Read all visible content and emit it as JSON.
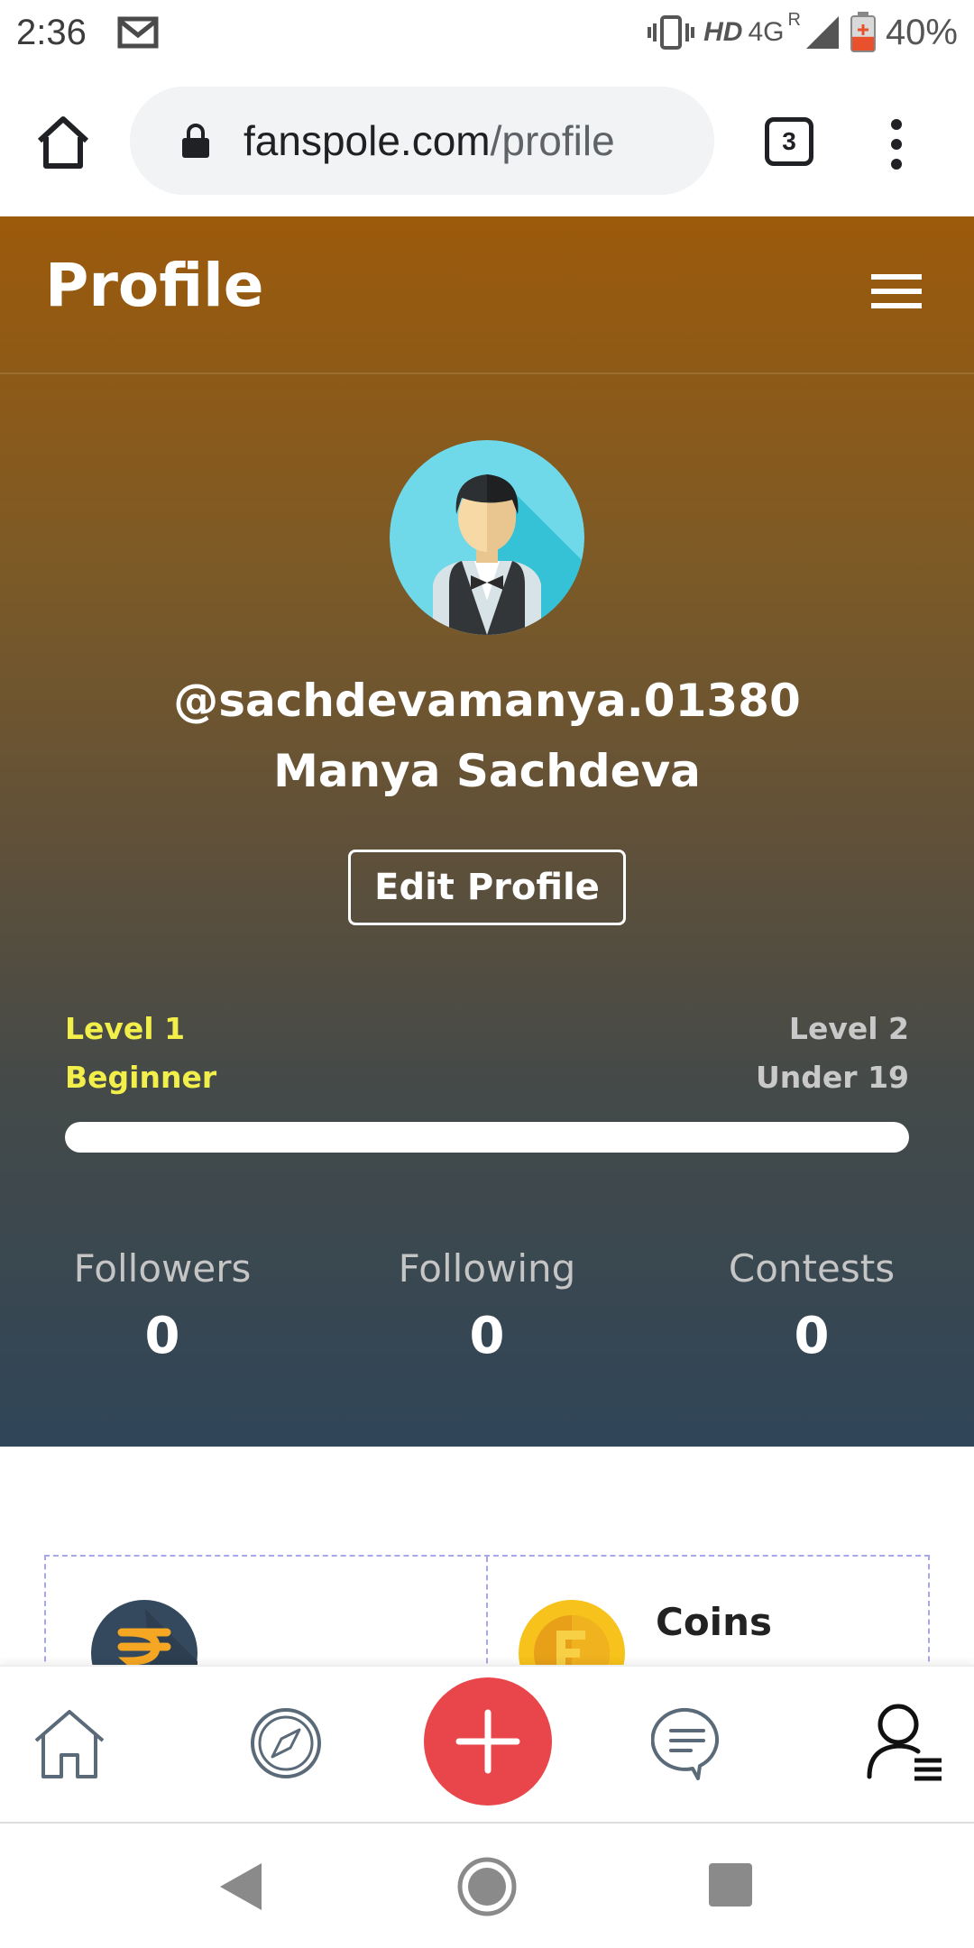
{
  "status_bar": {
    "time": "2:36",
    "network_type": "HD",
    "network_gen": "4G",
    "roaming_mark": "R",
    "battery_percent": "40%",
    "battery_level": 0.4,
    "icons": [
      "gmail-icon",
      "vibrate-icon",
      "signal-icon",
      "battery-icon"
    ]
  },
  "browser": {
    "url_host": "fanspole.com",
    "url_path": "/profile",
    "tab_count": "3",
    "icons": [
      "home-icon",
      "lock-icon",
      "overflow-menu-icon"
    ]
  },
  "header": {
    "title": "Profile",
    "menu_icon": "hamburger-icon"
  },
  "profile": {
    "avatar_icon": "waiter-avatar-icon",
    "handle": "@sachdevamanya.01380",
    "full_name": "Manya Sachdeva",
    "edit_button_label": "Edit Profile"
  },
  "level": {
    "current_level": "Level 1",
    "current_title": "Beginner",
    "next_level": "Level 2",
    "next_title": "Under 19",
    "progress": 0
  },
  "stats": [
    {
      "label": "Followers",
      "value": "0"
    },
    {
      "label": "Following",
      "value": "0"
    },
    {
      "label": "Contests",
      "value": "0"
    }
  ],
  "wallet": {
    "cash_icon": "rupee-icon",
    "coins_label": "Coins",
    "coins_icon": "coin-icon"
  },
  "bottom_nav": {
    "items": [
      "home-icon",
      "explore-icon",
      "add-icon",
      "chat-icon",
      "profile-menu-icon"
    ]
  },
  "colors": {
    "header_gradient_top": "#9c5a0b",
    "header_gradient_bottom": "#2f4558",
    "level_accent": "#f2ef4a",
    "add_button": "#e8464a",
    "wallet_border": "#a7a7ee"
  }
}
